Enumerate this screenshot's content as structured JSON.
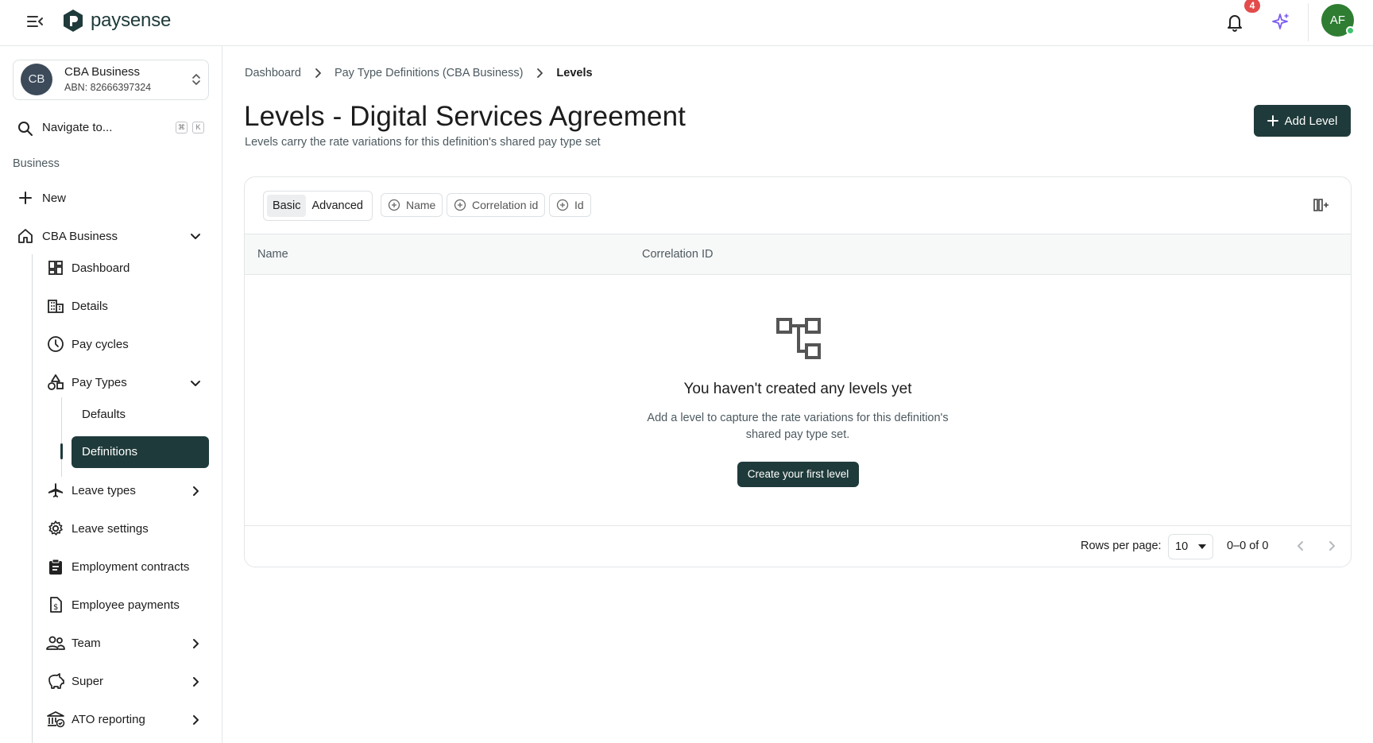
{
  "app": {
    "brand": "paysense",
    "notification_count": "4",
    "user_initials": "AF"
  },
  "org": {
    "initials": "CB",
    "name": "CBA Business",
    "abn": "ABN: 82666397324"
  },
  "sidebar": {
    "search_label": "Navigate to...",
    "kbd_cmd": "⌘",
    "kbd_k": "K",
    "section_label": "Business",
    "new_label": "New",
    "org_item": "CBA Business",
    "items": {
      "dashboard": "Dashboard",
      "details": "Details",
      "pay_cycles": "Pay cycles",
      "pay_types": "Pay Types",
      "defaults": "Defaults",
      "definitions": "Definitions",
      "leave_types": "Leave types",
      "leave_settings": "Leave settings",
      "employment_contracts": "Employment contracts",
      "employee_payments": "Employee payments",
      "team": "Team",
      "super": "Super",
      "ato_reporting": "ATO reporting"
    }
  },
  "breadcrumb": [
    "Dashboard",
    "Pay Type Definitions (CBA Business)",
    "Levels"
  ],
  "page": {
    "title": "Levels - Digital Services Agreement",
    "subtitle": "Levels carry the rate variations for this definition's shared pay type set",
    "add_button": "Add Level"
  },
  "filters": {
    "mode_basic": "Basic",
    "mode_advanced": "Advanced",
    "active_mode": "Basic",
    "chips": [
      "Name",
      "Correlation id",
      "Id"
    ]
  },
  "table": {
    "columns": [
      "Name",
      "Correlation ID"
    ],
    "rows": []
  },
  "empty_state": {
    "title": "You haven't created any levels yet",
    "line1": "Add a level to capture the rate variations for this definition's",
    "line2": "shared pay type set.",
    "button": "Create your first level"
  },
  "pagination": {
    "rows_per_page_label": "Rows per page:",
    "rows_per_page": "10",
    "range": "0–0 of 0"
  },
  "colors": {
    "accent": "#1f3a3a",
    "badge": "#e34b4b",
    "avatar": "#2e7d32",
    "sparkle": "#7c5cf0"
  }
}
